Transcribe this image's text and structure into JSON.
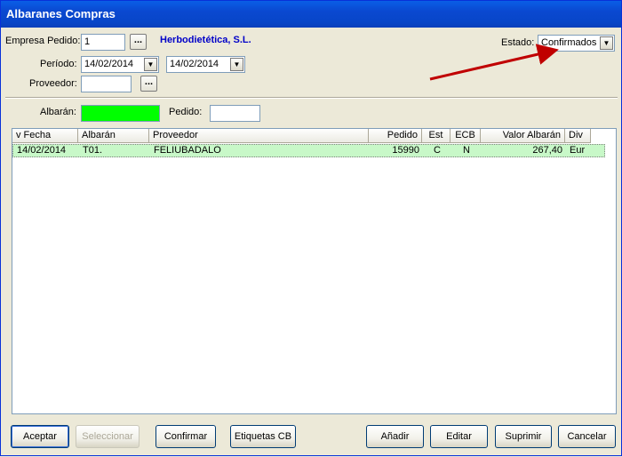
{
  "window": {
    "title": "Albaranes Compras"
  },
  "form": {
    "empresa_label": "Empresa Pedido:",
    "empresa_value": "1",
    "lookup_label": "...",
    "company_name": "Herbodietética, S.L.",
    "periodo_label": "Período:",
    "periodo_from": "14/02/2014",
    "periodo_to": "14/02/2014",
    "proveedor_label": "Proveedor:",
    "proveedor_value": "",
    "estado_label": "Estado:",
    "estado_value": "Confirmados",
    "albaran_label": "Albarán:",
    "albaran_value": "",
    "pedido_label": "Pedido:",
    "pedido_value": ""
  },
  "grid": {
    "columns": [
      "v Fecha",
      "Albarán",
      "Proveedor",
      "Pedido",
      "Est",
      "ECB",
      "Valor Albarán",
      "Div"
    ],
    "rows": [
      {
        "fecha": "14/02/2014",
        "albaran": "T01.",
        "proveedor": "FELIUBADALO",
        "pedido": "15990",
        "est": "C",
        "ecb": "N",
        "valor": "267,40",
        "div": "Eur"
      }
    ]
  },
  "buttons": {
    "aceptar": "Aceptar",
    "seleccionar": "Seleccionar",
    "confirmar": "Confirmar",
    "etiquetas": "Etiquetas CB",
    "anadir": "Añadir",
    "editar": "Editar",
    "suprimir": "Suprimir",
    "cancelar": "Cancelar"
  },
  "icons": {
    "dropdown": "chevron-down-icon",
    "annotation": "arrow-annotation"
  },
  "colors": {
    "title_bar": "#0a48d0",
    "albaran_field": "#00ff00",
    "selected_row": "#c8f8c8",
    "company_text": "#0000c8",
    "arrow": "#c00000"
  }
}
